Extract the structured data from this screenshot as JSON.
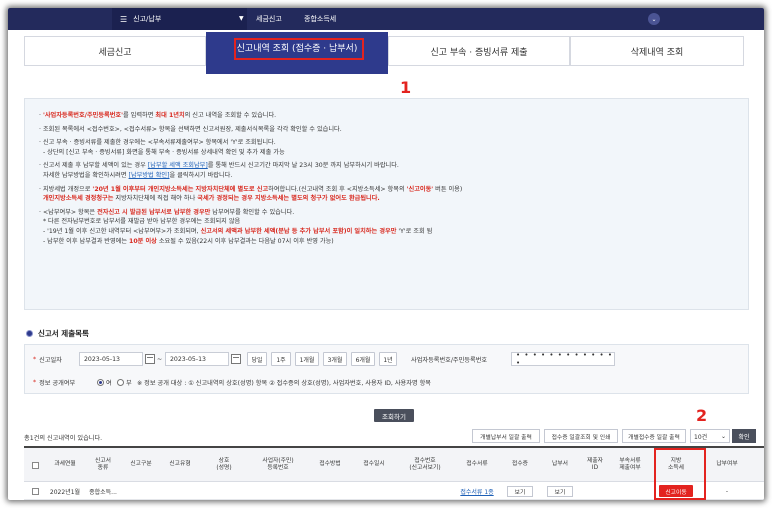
{
  "topnav": {
    "menu_label": "신고/납부",
    "crumb_1": "세금신고",
    "crumb_2": "종합소득세"
  },
  "tabs": [
    {
      "label": "세금신고"
    },
    {
      "label": "신고내역 조회 (접수증 · 납부서)",
      "active": true
    },
    {
      "label": "신고 부속 · 증빙서류 제출"
    },
    {
      "label": "삭제내역 조회"
    }
  ],
  "annotations": {
    "mark_1": "1",
    "mark_2": "2"
  },
  "info": {
    "l1_a": "'사업자등록번호/주민등록번호'",
    "l1_b": "를 입력하면 ",
    "l1_c": "최대 1년치",
    "l1_d": "의 신고 내역을 조회할 수 있습니다.",
    "l2": "조회된 목록에서 <접수번호>, <접수서류> 항목을 선택하면 신고서원장, 제출서식목록을 각각 확인할 수 있습니다.",
    "l3": "신고 부속 · 증빙서류를 제출한 경우에는 <부속서류제출여부> 항목에서 'Y'로 조회됩니다.",
    "l4": "- 상단의 [신고 부속 · 증빙서류] 화면을 통해 부속 · 증빙서류 상세내역 확인 및 추가 제출 가능",
    "l5_a": "신고서 제출 후 납부할 세액이 있는 경우 ",
    "l5_b": "[납부할 세액 조회납부]",
    "l5_c": "를 통해 반드시 신고기간 마지막 날 23시 30분 까지 납부하시기 바랍니다.",
    "l6_a": "자세한 납부방법을 확인하시려면 ",
    "l6_b": "[납부방법 확인]",
    "l6_c": "을 클릭하시기 바랍니다.",
    "l7_a": "지방세법 개정으로 ",
    "l7_b": "'20년 1월 이후부터 개인지방소득세는 지방자치단체에 별도로 신고",
    "l7_c": "하여합니다.(신고내역 조회 후 <지방소득세> 항목의 ",
    "l7_d": "'신고이동'",
    "l7_e": " 버튼 이용)",
    "l8_a": "개인지방소득세 경정청구는",
    "l8_b": " 지방자치단체에 직접 해야 하나 ",
    "l8_c": "국세가 경정되는 경우 지방소득세는 별도의 청구가 없어도 환급됩니다.",
    "l9_a": "<납부여부> 항목은 ",
    "l9_b": "전자신고 시 발급된 납부서로 납부한 경우만",
    "l9_c": " 납부여부를 확인할 수 있습니다.",
    "l10": "* 다른 전자납부번호로 납부서를 재발급 받아 납부한 경우에는 조회되지 않음",
    "l11_a": "- '19년 1월 이후 신고한 내역부터 <납부여부>가 조회되며, ",
    "l11_b": "신고서의 세액과 납부한 세액(분납 등 추가 납부서 포함)이 일치하는 경우만",
    "l11_c": " 'Y'로 조회 됨",
    "l12_a": "- 납부한 이후 납부결과 반영에는 ",
    "l12_b": "10분 이상",
    "l12_c": " 소요될 수 있음(22시 이후 납부결과는 다음날 07시 이후 반영 가능)"
  },
  "list_section": {
    "title": "신고서 제출목록",
    "period_label": "신고일자",
    "date_from": "2023-05-13",
    "date_to": "2023-05-13",
    "range_tilde": "~",
    "quick_periods": [
      "당일",
      "1주",
      "1개월",
      "3개월",
      "6개월",
      "1년"
    ],
    "id_label": "사업자등록번호/주민등록번호",
    "id_value": "• • • • • • • • • • • • •",
    "disclose_label": "정보 공개여부",
    "opt_yes": "여",
    "opt_no": "부",
    "disclose_note": "※ 정보 공개 대상 : ① 신고내역의 상호(성명) 항목 ② 접수증의 상호(성명), 사업자번호, 사용자 ID, 사용자명 항목",
    "search_button": "조회하기"
  },
  "results": {
    "count_text": "총1건의 신고내역이 있습니다.",
    "buttons": [
      "개별납부서 일괄 출력",
      "접수증 일괄조회 및 인쇄",
      "개별접수증 일괄 출력"
    ],
    "page_size": "10건",
    "go_button": "확인",
    "headers": [
      "",
      "과세연월",
      "신고서\n종류",
      "신고구분",
      "신고유형",
      "상호\n(성명)",
      "사업자(주민)\n등록번호",
      "접수방법",
      "접수일시",
      "접수번호\n(신고서보기)",
      "접수서류",
      "접수증",
      "납부서",
      "제출자\nID",
      "부속서류\n제출여부",
      "지방\n소득세",
      "납부여부"
    ],
    "rows": [
      {
        "period": "2022년1월",
        "type": "종합소득...",
        "docs": "접수서류 1종",
        "receipt_btn": "보기",
        "bill_btn": "보기",
        "local_btn": "신고이동",
        "paid": "-"
      }
    ]
  },
  "colors": {
    "nav": "#232a5c",
    "active_tab": "#2e3a8c",
    "highlight": "#e3231f"
  }
}
